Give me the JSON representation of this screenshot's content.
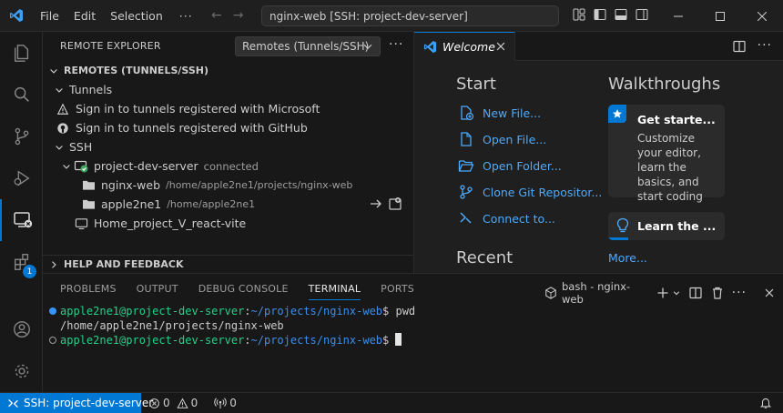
{
  "titlebar": {
    "menu": [
      "File",
      "Edit",
      "Selection"
    ],
    "search_text": "nginx-web [SSH: project-dev-server]"
  },
  "sidebar": {
    "title": "REMOTE EXPLORER",
    "remote_select": "Remotes (Tunnels/SSH)",
    "remotes_section": "REMOTES (TUNNELS/SSH)",
    "tunnels_label": "Tunnels",
    "tunnel_ms": "Sign in to tunnels registered with Microsoft",
    "tunnel_gh": "Sign in to tunnels registered with GitHub",
    "ssh_label": "SSH",
    "host": {
      "name": "project-dev-server",
      "status": "connected"
    },
    "folders": [
      {
        "name": "nginx-web",
        "path": "/home/apple2ne1/projects/nginx-web"
      },
      {
        "name": "apple2ne1",
        "path": "/home/apple2ne1"
      }
    ],
    "other_host": "Home_project_V_react-vite",
    "help_section": "HELP AND FEEDBACK"
  },
  "editor": {
    "tab_label": "Welcome",
    "start_heading": "Start",
    "start_items": [
      "New File...",
      "Open File...",
      "Open Folder...",
      "Clone Git Repositor...",
      "Connect to..."
    ],
    "recent_heading": "Recent",
    "walkthroughs_heading": "Walkthroughs",
    "walk_card_title": "Get starte...",
    "walk_card_desc": "Customize your editor, learn the basics, and start coding",
    "walk_card2_title": "Learn the ...",
    "more_link": "More...",
    "walk_progress": 0.17
  },
  "panel": {
    "tabs": [
      "PROBLEMS",
      "OUTPUT",
      "DEBUG CONSOLE",
      "TERMINAL",
      "PORTS"
    ],
    "active_tab": "TERMINAL",
    "terminal_name": "bash - nginx-web",
    "lines": {
      "l1_user": "apple2ne1@project-dev-server",
      "l1_path": "~/projects/nginx-web",
      "l1_cmd": "$ pwd",
      "l2_out": "/home/apple2ne1/projects/nginx-web",
      "l3_user": "apple2ne1@project-dev-server",
      "l3_path": "~/projects/nginx-web",
      "l3_prompt": "$ "
    }
  },
  "statusbar": {
    "remote": "SSH: project-dev-server",
    "errors": "0",
    "warnings": "0",
    "ports": "0"
  },
  "activity_badge": "1",
  "colors": {
    "accent": "#0078d4",
    "link": "#4daafc",
    "terminal_green": "#23d18b",
    "terminal_blue": "#3b8eea"
  }
}
